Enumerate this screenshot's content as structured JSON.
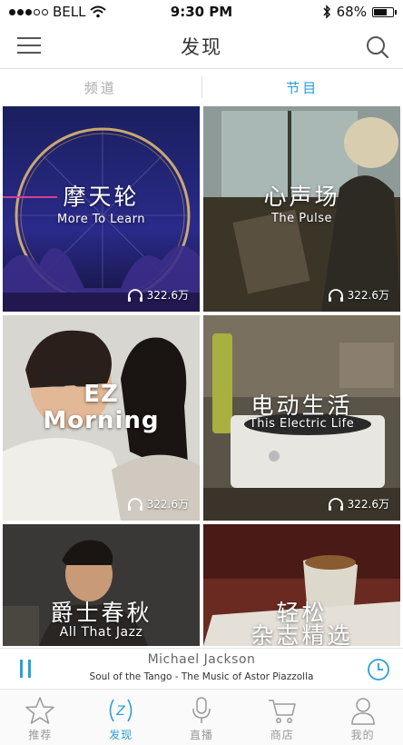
{
  "status_bar": {
    "carrier": "BELL",
    "time": "9:30 PM",
    "battery": "68%",
    "battery_level": 0.68
  },
  "nav": {
    "title": "发现"
  },
  "tabs": [
    {
      "label": "频道",
      "active": false
    },
    {
      "label": "节目",
      "active": true
    }
  ],
  "cards": [
    {
      "title_cn": "摩天轮",
      "title_en": "More To Learn",
      "listens": "322.6万"
    },
    {
      "title_cn": "心声场",
      "title_en": "The Pulse",
      "listens": "322.6万"
    },
    {
      "title_cn": "",
      "title_en_line1": "EZ",
      "title_en_line2": "Morning",
      "listens": "322.6万"
    },
    {
      "title_cn": "电动生活",
      "title_en": "This Electric Life",
      "listens": "322.6万"
    },
    {
      "title_cn": "爵士春秋",
      "title_en": "All That Jazz"
    },
    {
      "title_cn_line1": "轻松",
      "title_cn_line2": "杂志精选"
    }
  ],
  "player": {
    "artist": "Michael Jackson",
    "track": "Soul of the Tango - The Music of Astor Piazzolla"
  },
  "tabbar": [
    {
      "label": "推荐",
      "icon": "star-icon",
      "active": false
    },
    {
      "label": "发现",
      "icon": "discover-icon",
      "active": true
    },
    {
      "label": "直播",
      "icon": "microphone-icon",
      "active": false
    },
    {
      "label": "商店",
      "icon": "cart-icon",
      "active": false
    },
    {
      "label": "我的",
      "icon": "person-icon",
      "active": false
    }
  ],
  "colors": {
    "accent": "#2a9fd8"
  }
}
